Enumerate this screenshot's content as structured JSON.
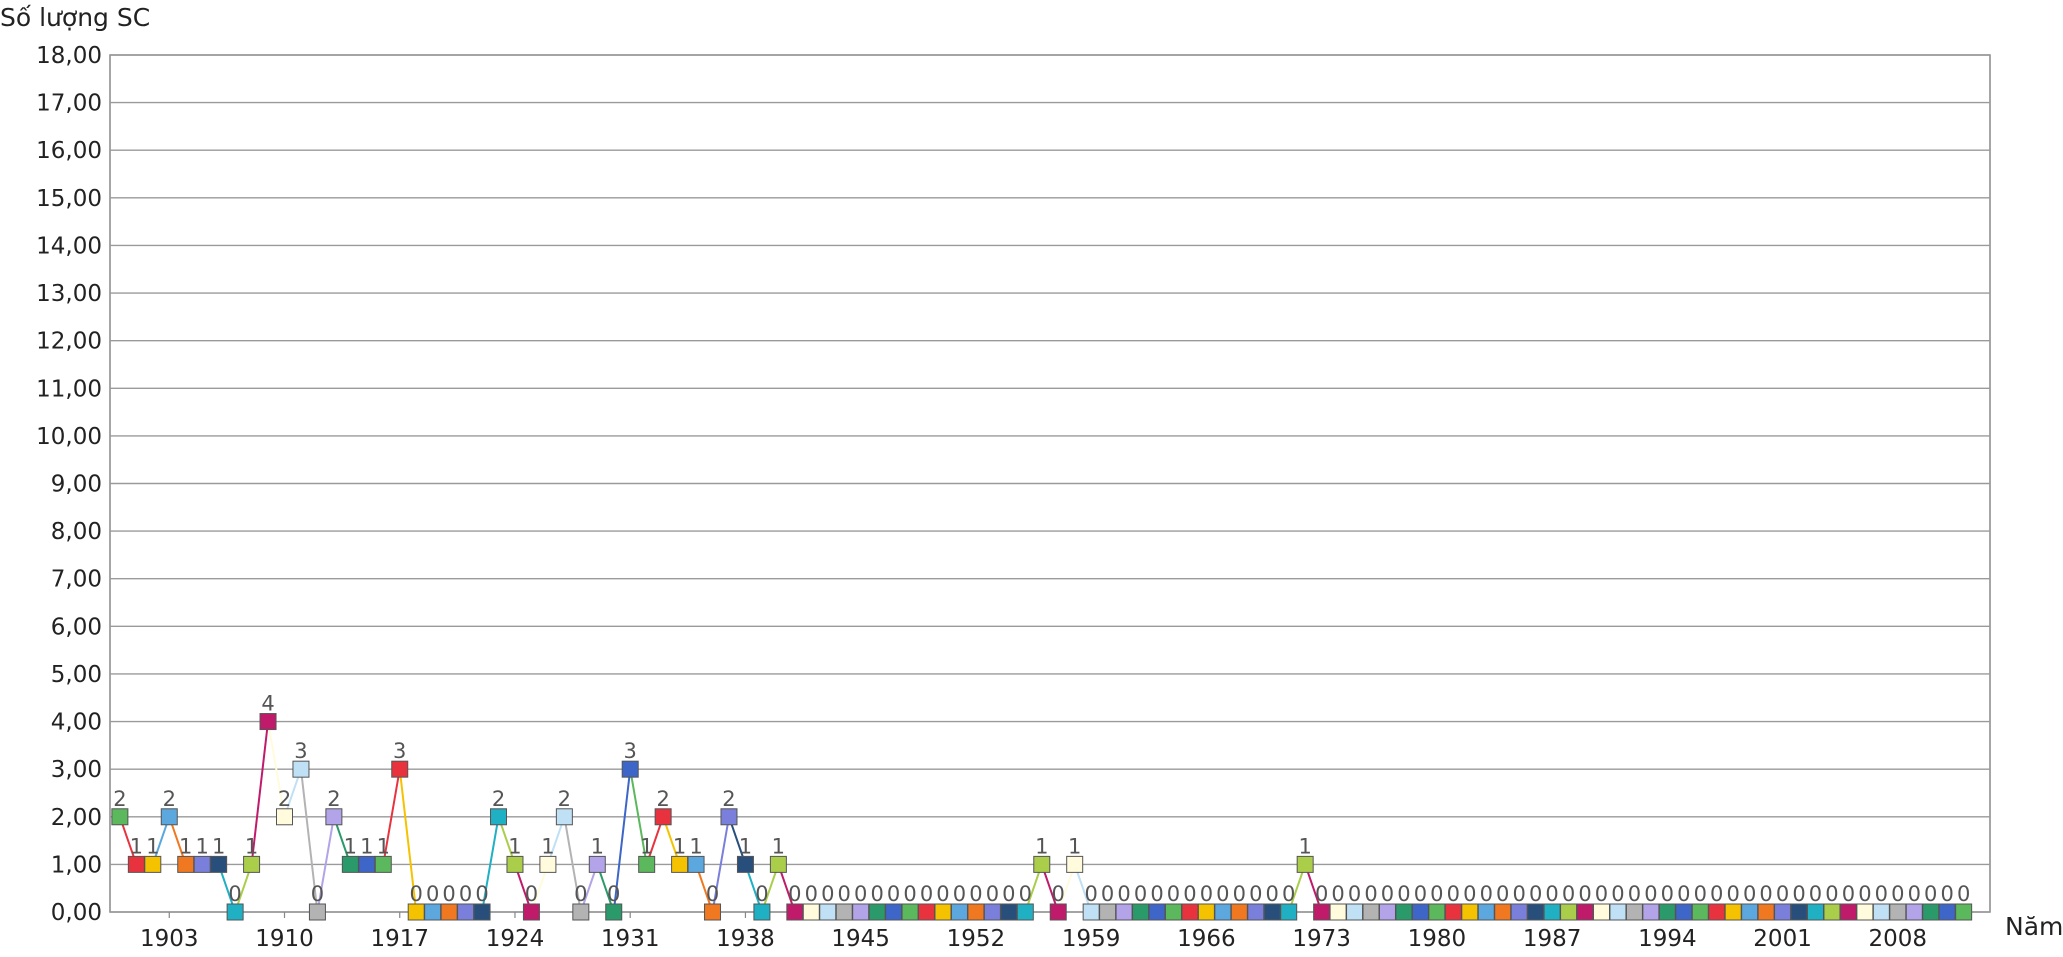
{
  "chart_data": {
    "type": "line",
    "ylabel": "Số lượng SC",
    "xlabel": "Năm",
    "ylim": [
      0,
      18
    ],
    "y_ticks": [
      "0,00",
      "1,00",
      "2,00",
      "3,00",
      "4,00",
      "5,00",
      "6,00",
      "7,00",
      "8,00",
      "9,00",
      "10,00",
      "11,00",
      "12,00",
      "13,00",
      "14,00",
      "15,00",
      "16,00",
      "17,00",
      "18,00"
    ],
    "x_tick_labels": [
      "1903",
      "1910",
      "1917",
      "1924",
      "1931",
      "1938",
      "1945",
      "1952",
      "1959",
      "1966",
      "1973",
      "1980",
      "1987",
      "1994",
      "2001",
      "2008"
    ],
    "grid": true,
    "marker": "square",
    "palette": [
      "#5cb85c",
      "#e8333f",
      "#f5c200",
      "#5ba7de",
      "#f07820",
      "#7a7fdb",
      "#284f7c",
      "#1fb0c4",
      "#aacd4a",
      "#c01b6a",
      "#fffbdc",
      "#bfe0f5",
      "#b3b3b3",
      "#b3a3e8",
      "#2a9a6a",
      "#3d66c8"
    ],
    "x": [
      1900,
      1901,
      1902,
      1903,
      1904,
      1905,
      1906,
      1907,
      1908,
      1909,
      1910,
      1911,
      1912,
      1913,
      1914,
      1915,
      1916,
      1917,
      1918,
      1919,
      1920,
      1921,
      1922,
      1923,
      1924,
      1925,
      1926,
      1927,
      1928,
      1929,
      1930,
      1931,
      1932,
      1933,
      1934,
      1935,
      1936,
      1937,
      1938,
      1939,
      1940,
      1941,
      1942,
      1943,
      1944,
      1945,
      1946,
      1947,
      1948,
      1949,
      1950,
      1951,
      1952,
      1953,
      1954,
      1955,
      1956,
      1957,
      1958,
      1959,
      1960,
      1961,
      1962,
      1963,
      1964,
      1965,
      1966,
      1967,
      1968,
      1969,
      1970,
      1971,
      1972,
      1973,
      1974,
      1975,
      1976,
      1977,
      1978,
      1979,
      1980,
      1981,
      1982,
      1983,
      1984,
      1985,
      1986,
      1987,
      1988,
      1989,
      1990,
      1991,
      1992,
      1993,
      1994,
      1995,
      1996,
      1997,
      1998,
      1999,
      2000,
      2001,
      2002,
      2003,
      2004,
      2005,
      2006,
      2007,
      2008,
      2009,
      2010,
      2011,
      2012
    ],
    "values": [
      2,
      1,
      1,
      2,
      1,
      1,
      1,
      0,
      1,
      4,
      2,
      3,
      0,
      2,
      1,
      1,
      1,
      3,
      0,
      0,
      0,
      0,
      0,
      2,
      1,
      0,
      1,
      2,
      0,
      1,
      0,
      3,
      1,
      2,
      1,
      1,
      0,
      2,
      1,
      0,
      1,
      0,
      0,
      0,
      0,
      0,
      0,
      0,
      0,
      0,
      0,
      0,
      0,
      0,
      0,
      0,
      1,
      0,
      1,
      0,
      0,
      0,
      0,
      0,
      0,
      0,
      0,
      0,
      0,
      0,
      0,
      0,
      1,
      0,
      0,
      0,
      0,
      0,
      0,
      0,
      0,
      0,
      0,
      0,
      0,
      0,
      0,
      0,
      0,
      0,
      0,
      0,
      0,
      0,
      0,
      0,
      0,
      0,
      0,
      0,
      0,
      0,
      0,
      0,
      0,
      0,
      0,
      0,
      0,
      0,
      0,
      0,
      0
    ],
    "labels_note": ""
  }
}
